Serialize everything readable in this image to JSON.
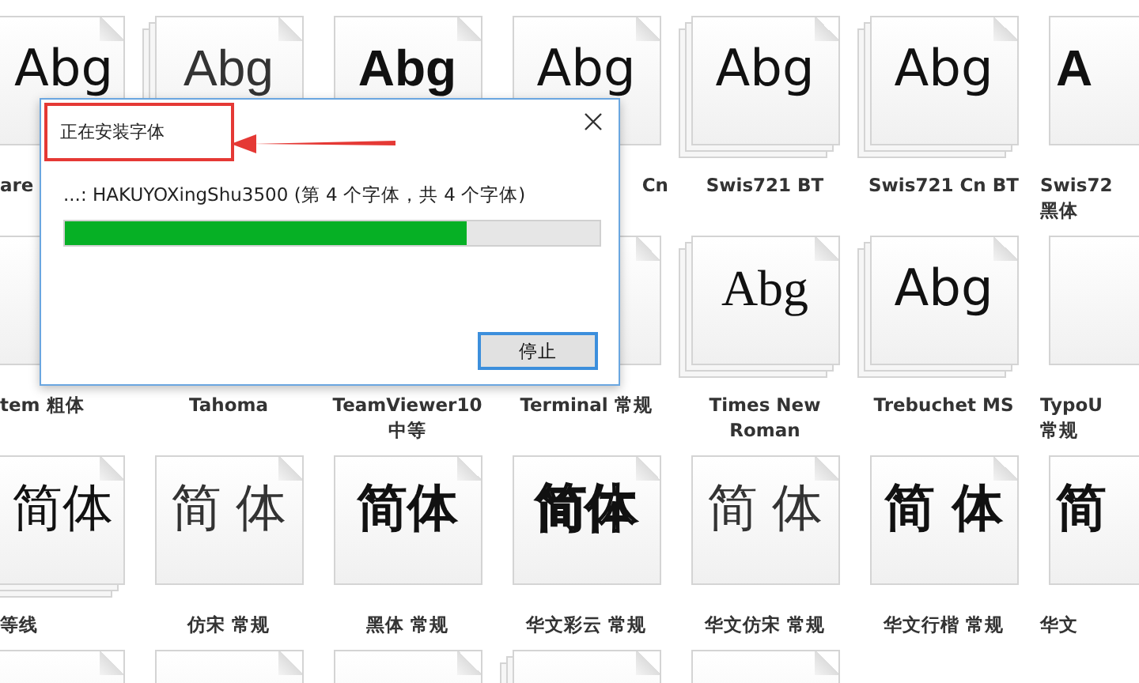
{
  "font_rows": [
    {
      "tiles": [
        {
          "preview": "Abg",
          "kind": "sans",
          "label": [
            "are"
          ]
        },
        {
          "preview": "Abg",
          "kind": "light",
          "stacked": true
        },
        {
          "preview": "Abg",
          "kind": "bold",
          "stacked": false
        },
        {
          "preview": "Abg",
          "kind": "tail",
          "stacked": false,
          "label": [
            "Cn"
          ]
        },
        {
          "preview": "Abg",
          "kind": "sans",
          "stacked": true,
          "label": [
            "Swis721 BT"
          ]
        },
        {
          "preview": "Abg",
          "kind": "sans",
          "stacked": true,
          "label": [
            "Swis721 Cn BT"
          ]
        },
        {
          "preview": "A",
          "kind": "bold",
          "stacked": false,
          "label": [
            "Swis72",
            "黑体"
          ]
        }
      ]
    },
    {
      "tiles": [
        {
          "label": [
            "tem 粗体"
          ]
        },
        {
          "label": [
            "Tahoma"
          ]
        },
        {
          "label": [
            "TeamViewer10",
            "中等"
          ]
        },
        {
          "label": [
            "Terminal 常规"
          ]
        },
        {
          "preview": "Abg",
          "kind": "serif",
          "stacked": true,
          "label": [
            "Times New",
            "Roman"
          ]
        },
        {
          "preview": "Abg",
          "kind": "sans",
          "stacked": true,
          "label": [
            "Trebuchet MS"
          ]
        },
        {
          "stacked": false,
          "label": [
            "TypoU",
            "常规"
          ]
        }
      ]
    },
    {
      "tiles": [
        {
          "preview": "简体",
          "kind": "sans",
          "stacked": true,
          "label": [
            "等线"
          ]
        },
        {
          "preview": "简 体",
          "kind": "light",
          "stacked": false,
          "label": [
            "仿宋 常规"
          ]
        },
        {
          "preview": "简体",
          "kind": "bold",
          "stacked": false,
          "label": [
            "黑体 常规"
          ]
        },
        {
          "preview": "简体",
          "kind": "outline",
          "stacked": false,
          "label": [
            "华文彩云 常规"
          ]
        },
        {
          "preview": "简 体",
          "kind": "light",
          "stacked": false,
          "label": [
            "华文仿宋 常规"
          ]
        },
        {
          "preview": "简 体",
          "kind": "brush",
          "stacked": false,
          "label": [
            "华文行楷 常规"
          ]
        },
        {
          "preview": "简",
          "kind": "bold",
          "stacked": false,
          "label": [
            "华文"
          ]
        }
      ]
    },
    {
      "cut_tile_at_left": true,
      "tiles": [
        {
          "stacked": false
        },
        {
          "stacked": false
        },
        {
          "stacked": true
        },
        {
          "stacked": false
        }
      ]
    }
  ],
  "dialog": {
    "title": "正在安装字体",
    "highlighted": true,
    "status": "...: HAKUYOXingShu3500 (第 4 个字体，共 4 个字体)",
    "progress": {
      "level": 0.75
    },
    "buttons": [
      "停止"
    ]
  }
}
